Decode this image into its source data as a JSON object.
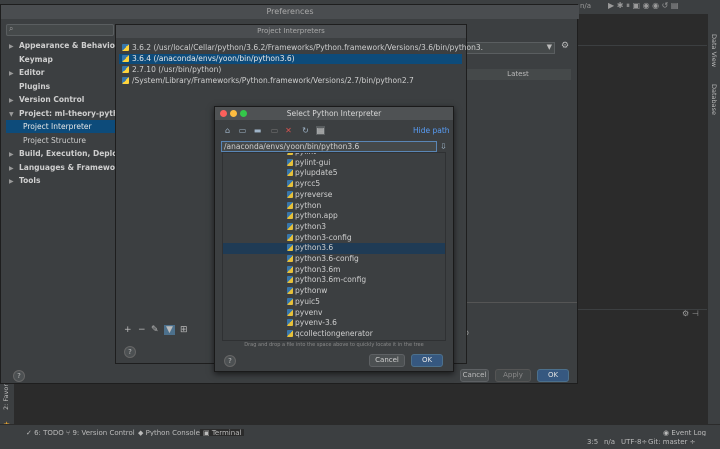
{
  "prefs": {
    "title": "Preferences",
    "tree": [
      {
        "label": "Appearance & Behavior",
        "arrow": "▶"
      },
      {
        "label": "Keymap",
        "arrow": ""
      },
      {
        "label": "Editor",
        "arrow": "▶"
      },
      {
        "label": "Plugins",
        "arrow": ""
      },
      {
        "label": "Version Control",
        "arrow": "▶"
      },
      {
        "label": "Project: ml-theory-python",
        "arrow": "▼"
      },
      {
        "label": "Project Interpreter",
        "arrow": ""
      },
      {
        "label": "Project Structure",
        "arrow": ""
      },
      {
        "label": "Build, Execution, Deployment",
        "arrow": "▶"
      },
      {
        "label": "Languages & Frameworks",
        "arrow": "▶"
      },
      {
        "label": "Tools",
        "arrow": "▶"
      }
    ],
    "latest_header": "Latest",
    "cancel": "Cancel",
    "apply": "Apply",
    "ok": "OK",
    "help": "?"
  },
  "project_interpreters": {
    "title": "Project Interpreters",
    "items": [
      "3.6.2 (/usr/local/Cellar/python/3.6.2/Frameworks/Python.framework/Versions/3.6/bin/python3.",
      "3.6.4 (/anaconda/envs/yoon/bin/python3.6)",
      "2.7.10 (/usr/bin/python)",
      "/System/Library/Frameworks/Python.framework/Versions/2.7/bin/python2.7"
    ],
    "help": "?"
  },
  "select_dialog": {
    "title": "Select Python Interpreter",
    "hide_path": "Hide path",
    "path_value": "/anaconda/envs/yoon/bin/python3.6",
    "files": [
      "pylint",
      "pylint-gui",
      "pylupdate5",
      "pyrcc5",
      "pyreverse",
      "python",
      "python.app",
      "python3",
      "python3-config",
      "python3.6",
      "python3.6-config",
      "python3.6m",
      "python3.6m-config",
      "pythonw",
      "pyuic5",
      "pyvenv",
      "pyvenv-3.6",
      "qcollectiongenerator"
    ],
    "selected_file": "python3.6",
    "drag_hint": "Drag and drop a file into the space above to quickly locate it in the tree",
    "cancel": "Cancel",
    "ok": "OK",
    "help": "?"
  },
  "status": {
    "todo": "6: TODO",
    "vcs": "9: Version Control",
    "python_console": "Python Console",
    "terminal": "Terminal",
    "event_log": "Event Log",
    "position": "3:5",
    "na": "n/a",
    "encoding": "UTF-8÷",
    "git": "Git: master ÷"
  },
  "side_tabs": {
    "data_view": "Data View",
    "database": "Database",
    "favorites": "2: Favor"
  },
  "nav": {
    "left_label": "n/a"
  }
}
